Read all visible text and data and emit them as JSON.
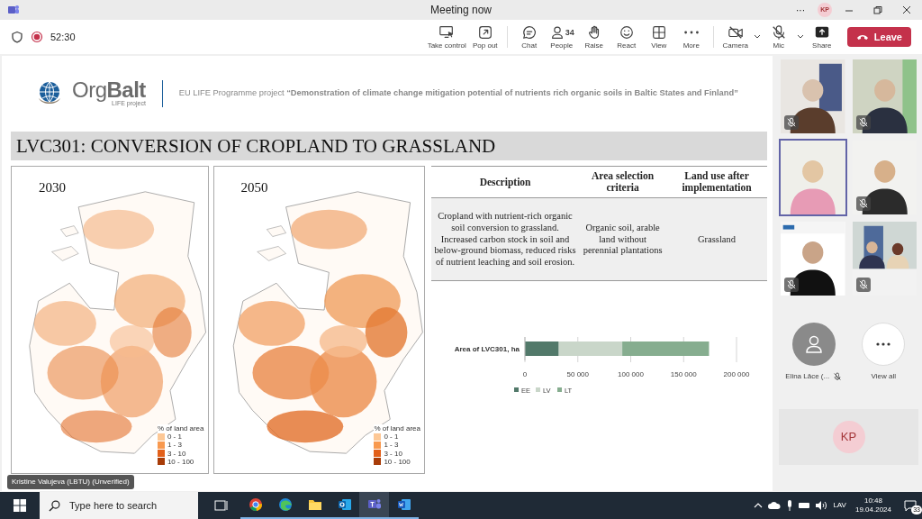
{
  "title_bar": {
    "title": "Meeting now",
    "more": "···",
    "avatar": "KP"
  },
  "toolbar": {
    "recording": true,
    "timer": "52:30",
    "share_tools": [
      {
        "label": "Take control"
      },
      {
        "label": "Pop out"
      }
    ],
    "actions": [
      {
        "label": "Chat"
      },
      {
        "label": "People",
        "count": "34"
      },
      {
        "label": "Raise"
      },
      {
        "label": "React"
      },
      {
        "label": "View"
      },
      {
        "label": "More"
      }
    ],
    "devices": [
      {
        "label": "Camera",
        "off": true
      },
      {
        "label": "Mic",
        "off": true
      }
    ],
    "share": "Share",
    "leave": "Leave"
  },
  "slide": {
    "logo": {
      "name": "Org**Balt**",
      "tagline": "LIFE project"
    },
    "project": "EU LIFE Programme project **“Demonstration of climate change mitigation potential of nutrients rich organic soils in Baltic States and Finland”**",
    "title": "LVC301: CONVERSION OF CROPLAND TO GRASSLAND",
    "maps": [
      {
        "year": "2030",
        "legend_title": "% of land area",
        "legend": [
          {
            "label": "0 - 1",
            "color": "#fdc896"
          },
          {
            "label": "1 - 3",
            "color": "#f8994f"
          },
          {
            "label": "3 - 10",
            "color": "#e2601a"
          },
          {
            "label": "10 - 100",
            "color": "#a83c08"
          }
        ]
      },
      {
        "year": "2050",
        "legend_title": "% of land area",
        "legend": [
          {
            "label": "0 - 1",
            "color": "#fdc896"
          },
          {
            "label": "1 - 3",
            "color": "#f8994f"
          },
          {
            "label": "3 - 10",
            "color": "#e2601a"
          },
          {
            "label": "10 - 100",
            "color": "#a83c08"
          }
        ]
      }
    ],
    "table": {
      "columns": [
        "Description",
        "Area selection criteria",
        "Land use after implementation"
      ],
      "rows": [
        [
          "Cropland with nutrient-rich organic soil conversion to grassland. Increased carbon stock in soil and below-ground biomass, reduced risks of nutrient leaching and soil erosion.",
          "Organic soil, arable land without perennial plantations",
          "Grassland"
        ]
      ]
    },
    "chart": {
      "chart_data": {
        "type": "bar",
        "orientation": "horizontal",
        "stacked": true,
        "categories": [
          "Area of LVC301, ha"
        ],
        "series": [
          {
            "name": "EE",
            "color": "#52796a",
            "values": [
              32000
            ]
          },
          {
            "name": "LV",
            "color": "#c9d6c9",
            "values": [
              60000
            ]
          },
          {
            "name": "LT",
            "color": "#86ad8f",
            "values": [
              82000
            ]
          }
        ],
        "legend": "bottom",
        "xlim": [
          0,
          200000
        ],
        "xticks": [
          {
            "value": 0,
            "label": "0"
          },
          {
            "value": 50000,
            "label": "50 000"
          },
          {
            "value": 100000,
            "label": "100 000"
          },
          {
            "value": 150000,
            "label": "150 000"
          },
          {
            "value": 200000,
            "label": "200 000"
          }
        ]
      }
    },
    "presenter": "Kristine Valujeva (LBTU) (Unverified)"
  },
  "participants": {
    "video_tiles": [
      {
        "muted": true,
        "speaking": false
      },
      {
        "muted": true,
        "speaking": false
      },
      {
        "muted": false,
        "speaking": true
      },
      {
        "muted": true,
        "speaking": false
      },
      {
        "muted": true,
        "speaking": false
      },
      {
        "muted": true,
        "speaking": false
      }
    ],
    "roster": [
      {
        "name": "Elina Lāce (...",
        "muted": true
      }
    ],
    "view_all": "View all",
    "self": "KP"
  },
  "taskbar": {
    "search_placeholder": "Type here to search",
    "apps": [
      {
        "running": false,
        "selected": false
      },
      {
        "running": true,
        "selected": false
      },
      {
        "running": true,
        "selected": false
      },
      {
        "running": true,
        "selected": false
      },
      {
        "running": true,
        "selected": false
      },
      {
        "running": true,
        "selected": true
      },
      {
        "running": true,
        "selected": false
      }
    ],
    "language": "LAV",
    "time": "10:48",
    "date": "19.04.2024",
    "notifications": "33"
  }
}
